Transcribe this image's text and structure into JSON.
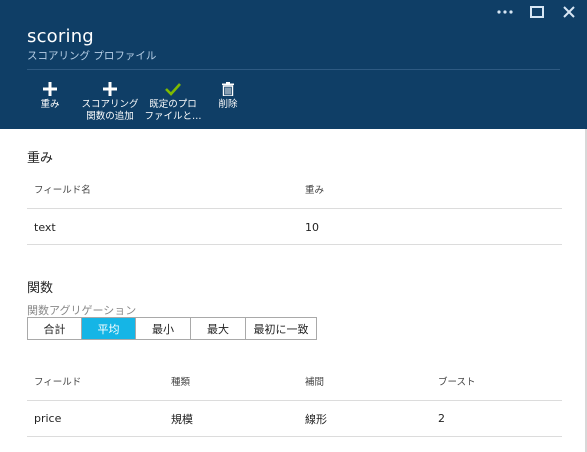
{
  "window": {
    "title": "scoring",
    "subtitle": "スコアリング プロファイル"
  },
  "toolbar": {
    "weights_label": "重み",
    "add_function_line1": "スコアリング",
    "add_function_line2": "関数の追加",
    "default_profile_line1": "既定のプロ",
    "default_profile_line2": "ファイルと…",
    "delete_label": "削除"
  },
  "weights": {
    "heading": "重み",
    "columns": [
      "フィールド名",
      "重み"
    ],
    "rows": [
      {
        "field": "text",
        "weight": "10"
      }
    ]
  },
  "functions": {
    "heading": "関数",
    "aggregation_label": "関数アグリゲーション",
    "aggregation_options": [
      "合計",
      "平均",
      "最小",
      "最大",
      "最初に一致"
    ],
    "aggregation_selected": "平均",
    "columns": [
      "フィールド",
      "種類",
      "補間",
      "ブースト"
    ],
    "rows": [
      {
        "field": "price",
        "type": "規模",
        "interpolation": "線形",
        "boost": "2"
      }
    ]
  },
  "colors": {
    "header_bg": "#0f3e66",
    "accent": "#15b5e6",
    "check": "#7fba00"
  },
  "icons": {
    "window_controls": [
      "ellipsis-icon",
      "maximize-icon",
      "close-icon"
    ],
    "toolbar": [
      "plus-icon",
      "plus-icon",
      "checkmark-icon",
      "trash-icon"
    ]
  }
}
